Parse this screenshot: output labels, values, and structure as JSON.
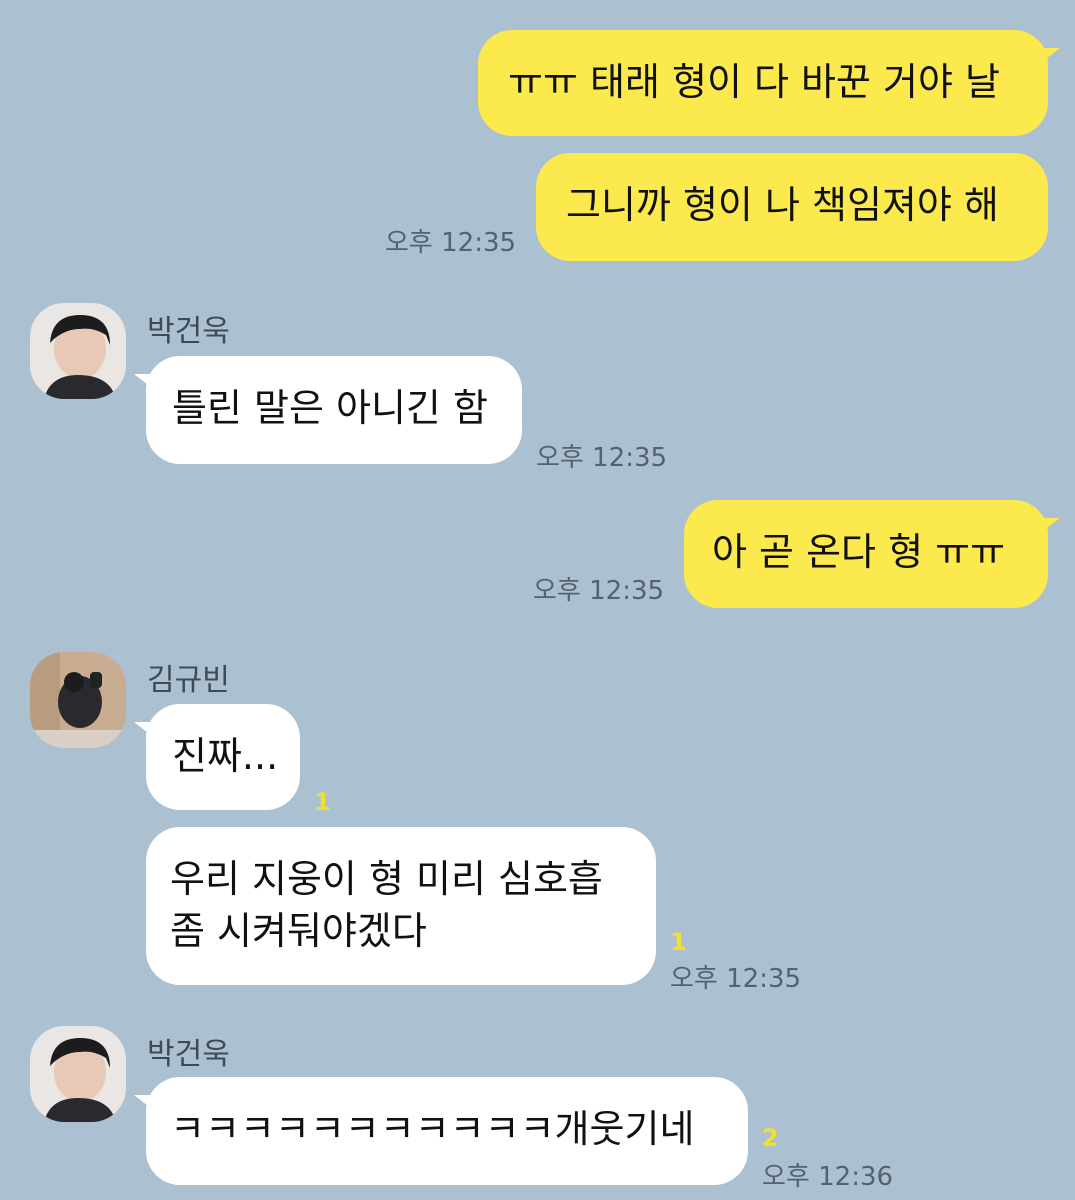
{
  "messages": {
    "m1": {
      "text": "ㅠㅠ 태래 형이 다 바꾼 거야 날"
    },
    "m2": {
      "text": "그니까 형이 나 책임져야 해",
      "time": "오후 12:35"
    },
    "m3": {
      "sender": "박건욱",
      "text": "틀린 말은 아니긴 함",
      "time": "오후 12:35"
    },
    "m4": {
      "text": "아 곧 온다 형 ㅠㅠ",
      "time": "오후 12:35"
    },
    "m5": {
      "sender": "김규빈",
      "text": "진짜...",
      "unread": "1"
    },
    "m6": {
      "line1": "우리 지웅이 형 미리 심호흡",
      "line2": "좀 시켜둬야겠다",
      "unread": "1",
      "time": "오후 12:35"
    },
    "m7": {
      "sender": "박건욱",
      "text": "ㅋㅋㅋㅋㅋㅋㅋㅋㅋㅋㅋ개웃기네",
      "unread": "2",
      "time": "오후 12:36"
    }
  },
  "colors": {
    "background": "#abc1d1",
    "my_bubble": "#fbe94e",
    "their_bubble": "#ffffff",
    "unread_count": "#f4e02a"
  },
  "icons": [
    "avatar-park-geonwook",
    "avatar-kim-gyubin"
  ]
}
